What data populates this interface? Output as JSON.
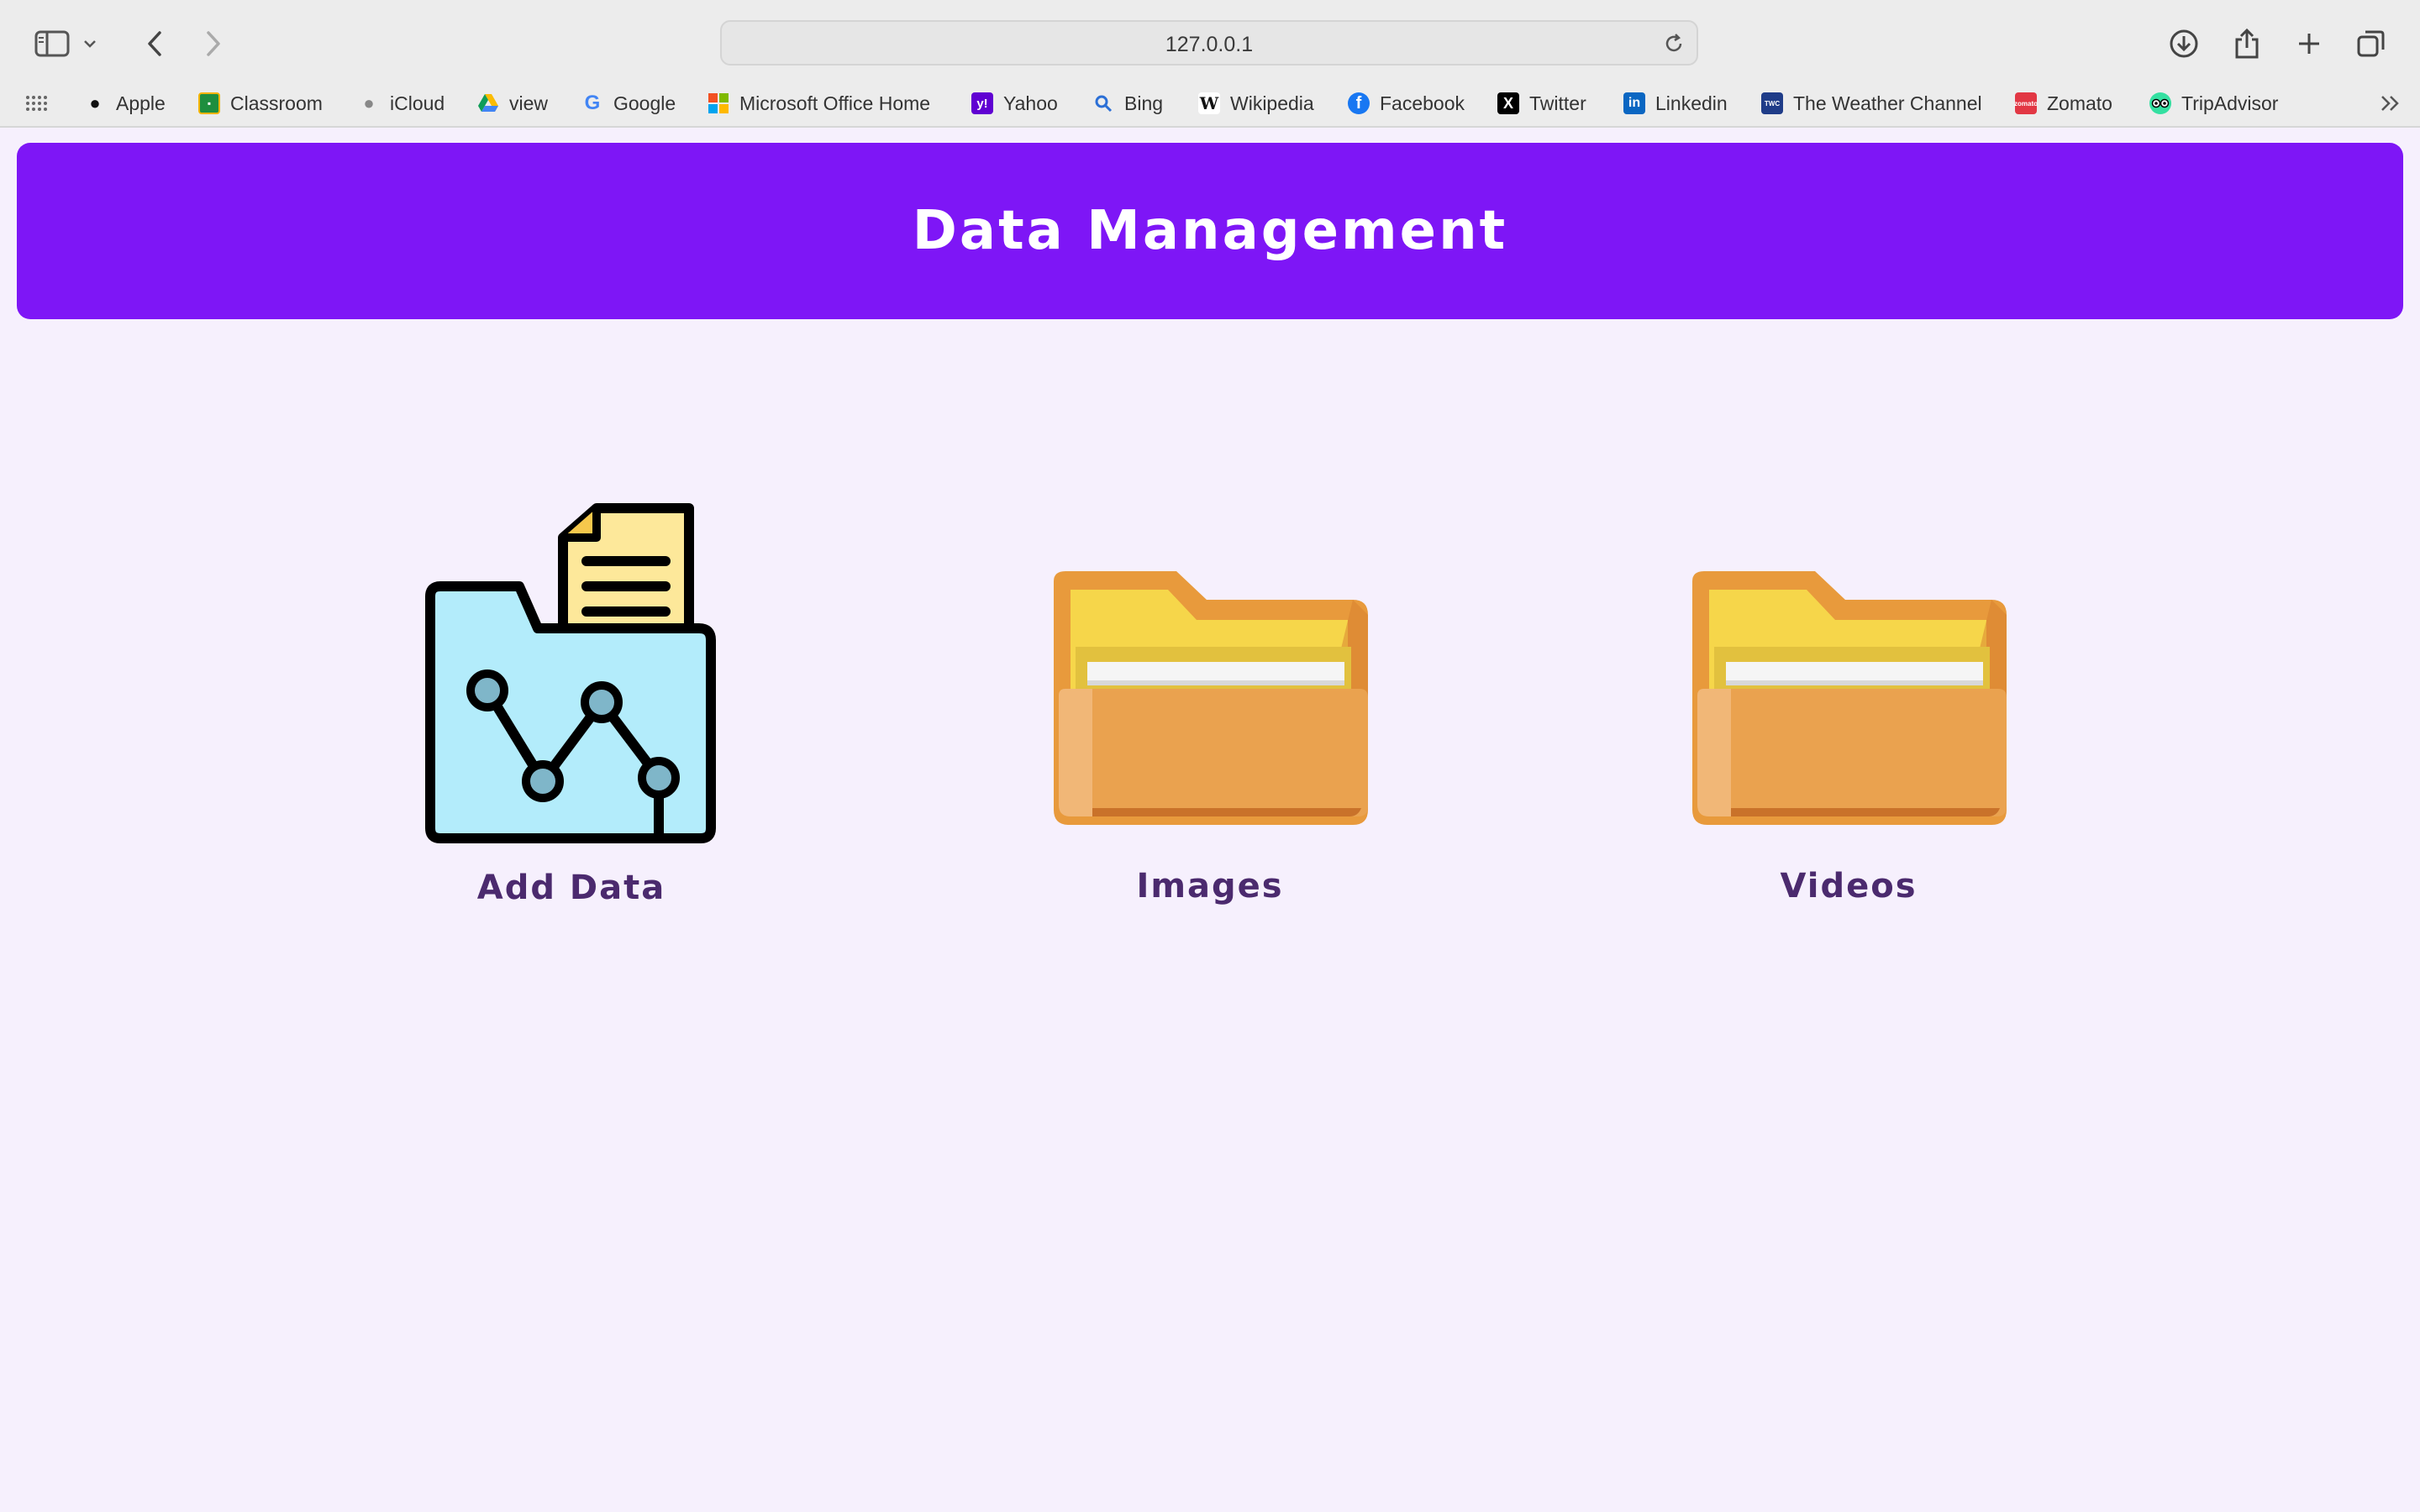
{
  "browser": {
    "url": "127.0.0.1",
    "bookmarks": [
      {
        "label": "Apple",
        "icon": "apple-icon"
      },
      {
        "label": "Classroom",
        "icon": "classroom-icon"
      },
      {
        "label": "iCloud",
        "icon": "icloud-icon"
      },
      {
        "label": "view",
        "icon": "google-drive-icon"
      },
      {
        "label": "Google",
        "icon": "google-icon"
      },
      {
        "label": "Microsoft Office Home",
        "icon": "microsoft-icon"
      },
      {
        "label": "Yahoo",
        "icon": "yahoo-icon"
      },
      {
        "label": "Bing",
        "icon": "bing-search-icon"
      },
      {
        "label": "Wikipedia",
        "icon": "wikipedia-icon"
      },
      {
        "label": "Facebook",
        "icon": "facebook-icon"
      },
      {
        "label": "Twitter",
        "icon": "x-twitter-icon"
      },
      {
        "label": "Linkedin",
        "icon": "linkedin-icon"
      },
      {
        "label": "The Weather Channel",
        "icon": "weather-channel-icon"
      },
      {
        "label": "Zomato",
        "icon": "zomato-icon"
      },
      {
        "label": "TripAdvisor",
        "icon": "tripadvisor-icon"
      }
    ]
  },
  "header": {
    "title": "Data Management",
    "background": "#7e16f6"
  },
  "cards": [
    {
      "label": "Add Data",
      "icon": "data-folder-icon"
    },
    {
      "label": "Images",
      "icon": "folder-icon"
    },
    {
      "label": "Videos",
      "icon": "folder-icon"
    }
  ]
}
